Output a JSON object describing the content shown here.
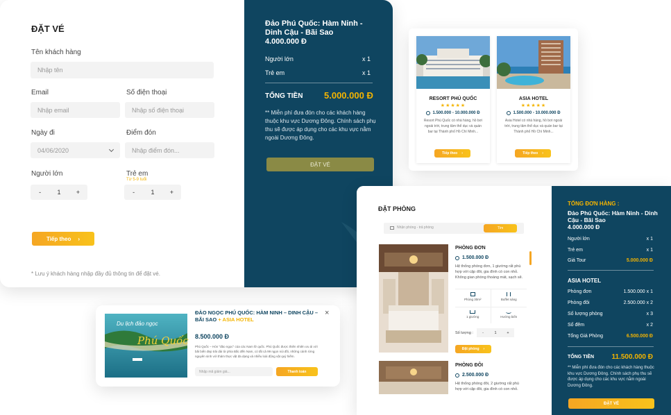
{
  "booking": {
    "title": "ĐẶT VÉ",
    "name_label": "Tên khách hàng",
    "name_placeholder": "Nhập tên",
    "email_label": "Email",
    "email_placeholder": "Nhập email",
    "phone_label": "Số điện thoại",
    "phone_placeholder": "Nhập số điện thoại",
    "date_label": "Ngày đi",
    "date_value": "04/06/2020",
    "pickup_label": "Điểm đón",
    "pickup_placeholder": "Nhập điểm đón...",
    "adult_label": "Người lớn",
    "child_label": "Trẻ em",
    "child_note": "Từ 5-9 tuổi",
    "minus": "-",
    "plus": "+",
    "adult_count": "1",
    "child_count": "1",
    "next_button": "Tiếp theo",
    "footnote": "* Lưu ý khách hàng nhập đầy đủ thông tin để đặt vé."
  },
  "summary": {
    "tour_name": "Đảo Phú Quốc: Hàm Ninh - Dinh Cậu - Bãi Sao",
    "tour_price": "4.000.000 Đ",
    "adult": "Người lớn",
    "adult_qty": "x 1",
    "child": "Trẻ em",
    "child_qty": "x 1",
    "total_label": "TỔNG TIỀN",
    "total_value": "5.000.000 Đ",
    "note": "** Miễn phí đưa đón cho các khách hàng thuộc khu vực Dương Đông. Chính sách phụ thu sẽ được áp dụng cho các khu vực nằm ngoài Dương Đông.",
    "book_button": "ĐẶT VÉ"
  },
  "hotels": [
    {
      "name": "RESORT PHÚ QUỐC",
      "price": "1.500.000 - 10.000.000 Đ",
      "desc": "Resort Phú Quốc có nhà hàng, hồ bơi ngoài trời, trung tâm thể dục và quán bar tại Thành phố Hồ Chí Minh...",
      "button": "Tiếp theo",
      "stars": "★★★★★"
    },
    {
      "name": "ASIA HOTEL",
      "price": "1.500.000 - 10.000.000 Đ",
      "desc": "Asia Hotel có nhà hàng, hồ bơi ngoài trời, trung tâm thể dục và quán bar tại Thành phố Hồ Chí Minh...",
      "button": "Tiếp theo",
      "stars": "★★★★★"
    }
  ],
  "promo": {
    "title": "ĐẢO NGỌC PHÚ QUỐC: HÀM NINH – DINH CẬU – BÃI SAO",
    "title_suffix": "+ ASIA HOTEL",
    "price": "8.500.000 Đ",
    "desc": "Phú Quốc – Hòn \"đảo ngọc\" của các Nam lữ quốc. Phú Quốc được thiên nhiên ưu ái với bãi biển đẹp trải dài từ phía Bắc đến Nam, có tất cả 99 ngọn núi đồi, những cánh rừng nguyên sinh với thảm thực vật đa dạng và nhiều loài động vật quý hiếm.",
    "image_script": "Du lịch đảo ngọc",
    "image_title": "Phú Quốc",
    "coupon_placeholder": "Nhập mã giảm giá...",
    "pay_button": "Thanh toán",
    "close": "×"
  },
  "rooms": {
    "title": "ĐẶT PHÒNG",
    "search_placeholder": "Nhận phòng - trả phòng",
    "search_button": "Tìm",
    "room1": {
      "name": "PHÒNG ĐƠN",
      "price": "1.500.000 Đ",
      "desc": "Hệ thống phòng đơn, 1 giường rất phù hợp với cặp đôi, gia đình có con nhỏ. Không gian phòng thoáng mát, sạch sẽ.",
      "amenities": [
        "Phòng 30m²",
        "Buffet sáng",
        "1 giường",
        "Hướng biển"
      ],
      "qty_label": "Số lượng :",
      "qty": "1",
      "button": "Đặt phòng"
    },
    "room2": {
      "name": "PHÒNG ĐÔI",
      "price": "2.500.000 Đ",
      "desc": "Hệ thống phòng đôi, 2 giường rất phù hợp với cặp đôi, gia đình có con nhỏ."
    }
  },
  "order": {
    "title": "TỔNG ĐƠN HÀNG :",
    "tour_name": "Đảo Phú Quốc: Hàm Ninh - Dinh Cậu - Bãi Sao",
    "tour_price": "4.000.000 Đ",
    "adult": "Người lớn",
    "adult_qty": "x 1",
    "child": "Trẻ em",
    "child_qty": "x 1",
    "tour_total_label": "Giá Tour",
    "tour_total": "5.000.000 Đ",
    "hotel_name": "ASIA HOTEL",
    "lines": [
      {
        "label": "Phòng đơn",
        "value": "1.500.000 x 1"
      },
      {
        "label": "Phòng đôi",
        "value": "2.500.000 x 2"
      },
      {
        "label": "Số lượng phòng",
        "value": "x 3"
      },
      {
        "label": "Số đêm",
        "value": "x 2"
      }
    ],
    "room_total_label": "Tổng Giá Phòng",
    "room_total": "6.500.000 Đ",
    "grand_label": "TỔNG TIỀN",
    "grand_total": "11.500.000 Đ",
    "note": "** Miễn phí đưa đón cho các khách hàng thuộc khu vực Dương Đông. Chính sách phụ thu sẽ được áp dụng cho các khu vực nằm ngoài Dương Đông.",
    "book_button": "ĐẶT VÉ"
  },
  "colors": {
    "navy": "#0f4560",
    "gold": "#f4b400",
    "olive_button": "#8a8a45"
  }
}
